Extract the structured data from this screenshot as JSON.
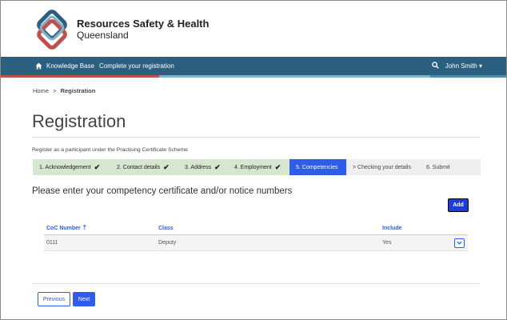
{
  "brand": {
    "title": "Resources Safety & Health",
    "subtitle": "Queensland"
  },
  "nav": {
    "links": [
      "Knowledge Base",
      "Complete your registration"
    ],
    "user": "John Smith",
    "user_caret": "▾",
    "bar_color": "#2b5f80"
  },
  "breadcrumb": {
    "home": "Home",
    "separator": ">",
    "current": "Registration"
  },
  "page": {
    "title": "Registration",
    "intro": "Register as a participant under the Practising Certificate Scheme",
    "subheading": "Please enter your competency certificate and/or notice numbers"
  },
  "steps": [
    {
      "label": "1. Acknowledgement",
      "status": "done"
    },
    {
      "label": "2. Contact details",
      "status": "done"
    },
    {
      "label": "3. Address",
      "status": "done"
    },
    {
      "label": "4. Employment",
      "status": "done"
    },
    {
      "label": "5. Competencies",
      "status": "active"
    },
    {
      "label": "> Checking your details",
      "status": "todo"
    },
    {
      "label": "6. Submit",
      "status": "todo"
    }
  ],
  "table": {
    "add_label": "Add",
    "columns": [
      "CoC Number",
      "Class",
      "Include"
    ],
    "sort_glyph": "🡑",
    "rows": [
      {
        "coc": "0111",
        "class": "Deputy",
        "include": "Yes"
      }
    ]
  },
  "footer": {
    "previous_label": "Previous",
    "next_label": "Next"
  },
  "colors": {
    "accent": "#2f5ce8",
    "done_step": "#d6e6cf",
    "stripe_red": "#c0504d",
    "stripe_teal": "#4a8fa8"
  }
}
